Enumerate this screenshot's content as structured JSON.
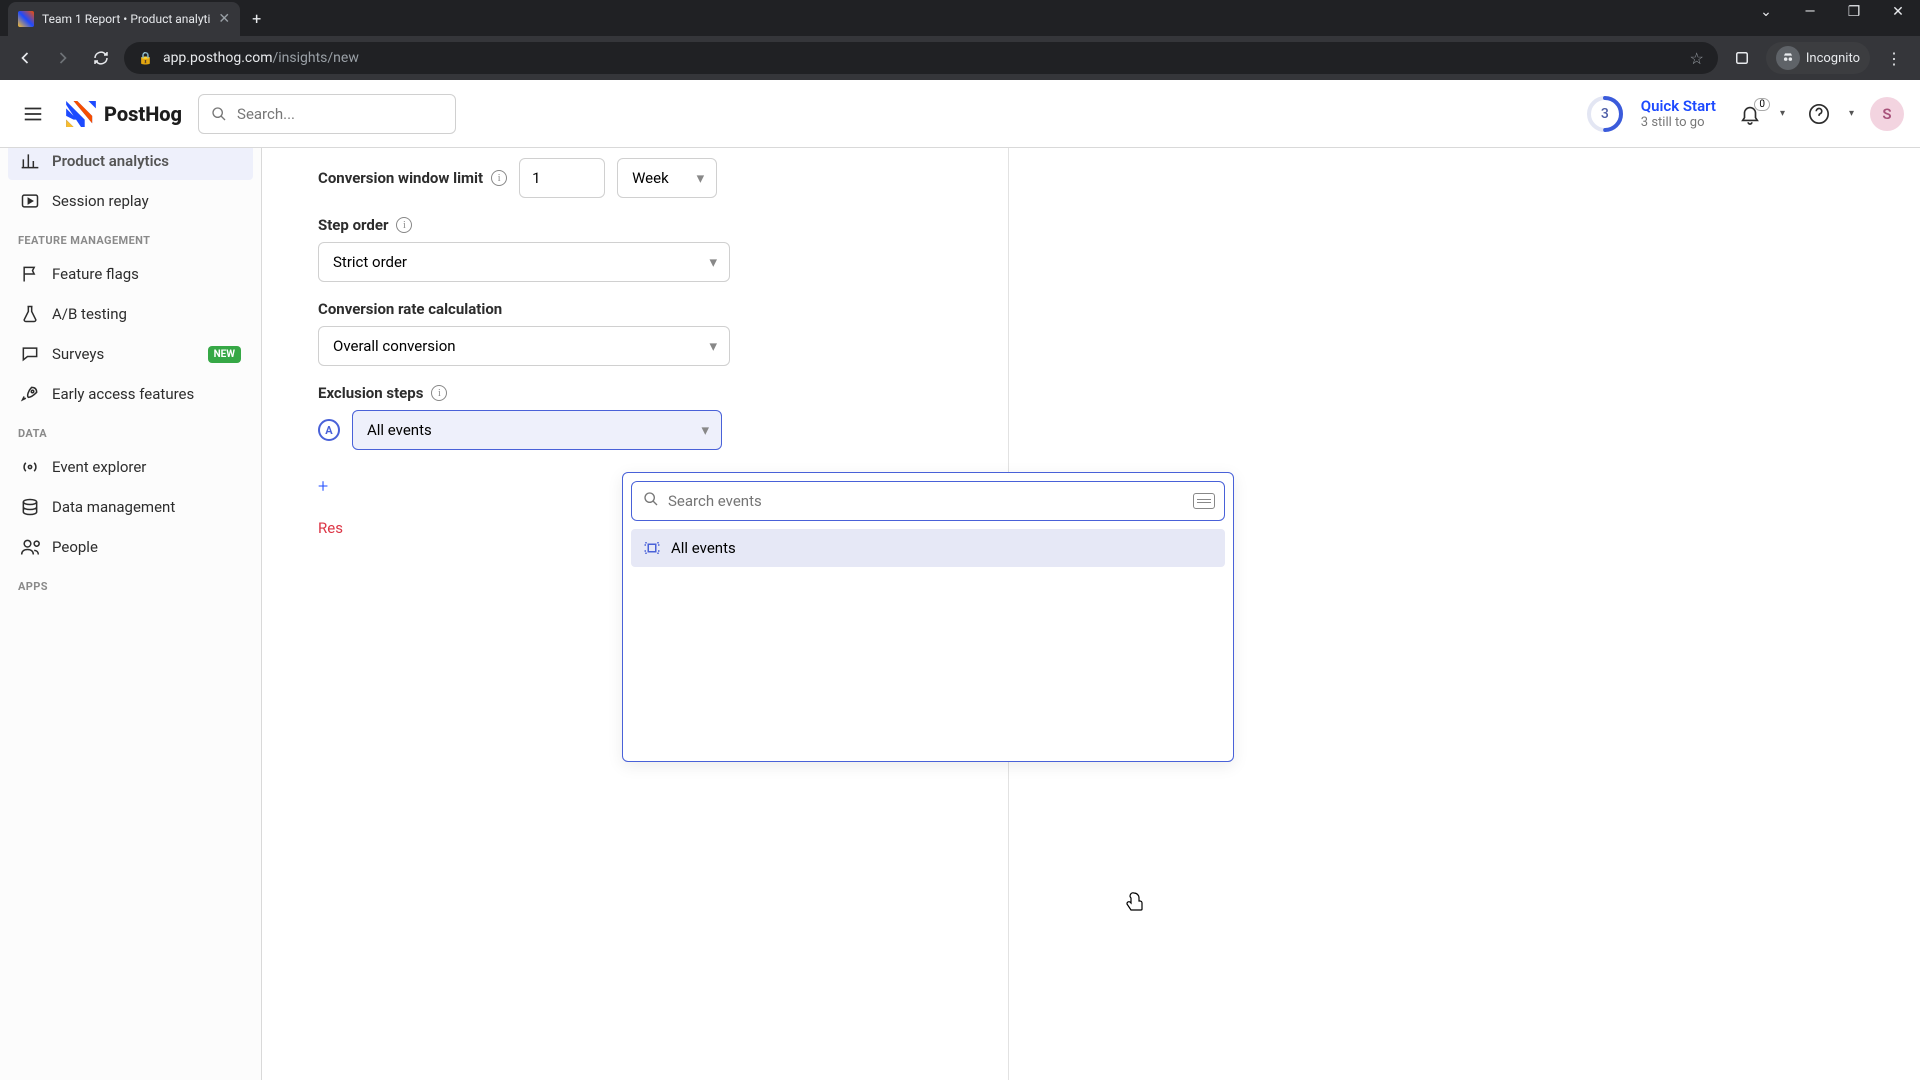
{
  "browser": {
    "tab_title": "Team 1 Report • Product analyti",
    "url_host": "app.posthog.com",
    "url_path": "/insights/new",
    "incognito_label": "Incognito"
  },
  "header": {
    "search_placeholder": "Search...",
    "quickstart_title": "Quick Start",
    "quickstart_sub": "3 still to go",
    "quickstart_count": "3",
    "notif_count": "0",
    "user_initial": "S"
  },
  "logo_text": "PostHog",
  "sidebar": {
    "product_analytics": "Product analytics",
    "session_replay": "Session replay",
    "section_feature": "FEATURE MANAGEMENT",
    "feature_flags": "Feature flags",
    "ab_testing": "A/B testing",
    "surveys": "Surveys",
    "surveys_badge": "NEW",
    "early_access": "Early access features",
    "section_data": "DATA",
    "event_explorer": "Event explorer",
    "data_management": "Data management",
    "people": "People",
    "section_apps": "APPS"
  },
  "form": {
    "conversion_window_label": "Conversion window limit",
    "conversion_window_value": "1",
    "conversion_window_unit": "Week",
    "step_order_label": "Step order",
    "step_order_value": "Strict order",
    "conversion_rate_label": "Conversion rate calculation",
    "conversion_rate_value": "Overall conversion",
    "exclusion_label": "Exclusion steps",
    "exclusion_value": "All events",
    "step_badge": "A",
    "reset_text": "Res"
  },
  "popover": {
    "search_placeholder": "Search events",
    "option_all": "All events"
  }
}
